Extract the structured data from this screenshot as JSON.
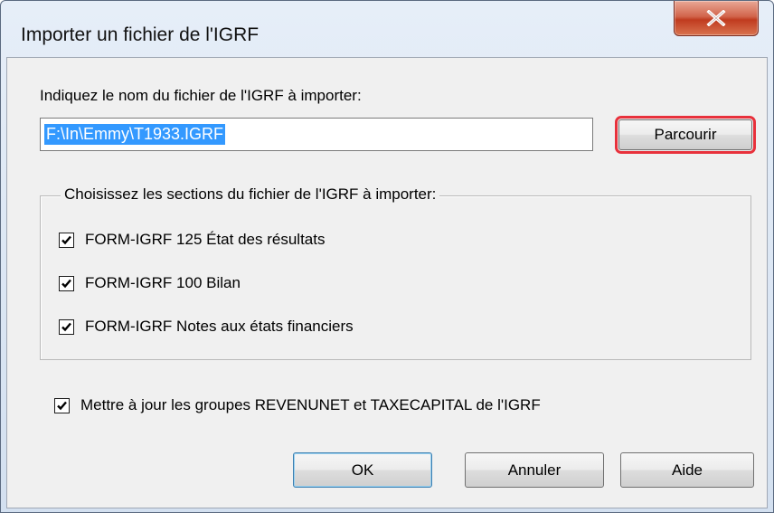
{
  "window": {
    "title": "Importer un fichier de l'IGRF",
    "close_glyph": "X"
  },
  "file": {
    "label": "Indiquez le nom du fichier de l'IGRF à importer:",
    "value": "F:\\In\\Emmy\\T1933.IGRF",
    "browse_label": "Parcourir"
  },
  "sections": {
    "legend": "Choisissez les sections du fichier de l'IGRF à importer:",
    "items": [
      {
        "label": "FORM-IGRF  125 État des résultats",
        "checked": true
      },
      {
        "label": "FORM-IGRF  100 Bilan",
        "checked": true
      },
      {
        "label": "FORM-IGRF  Notes aux états financiers",
        "checked": true
      }
    ]
  },
  "update_option": {
    "label": "Mettre à jour les groupes REVENUNET et TAXECAPITAL de l'IGRF",
    "checked": true
  },
  "buttons": {
    "ok": "OK",
    "cancel": "Annuler",
    "help": "Aide"
  },
  "colors": {
    "selection": "#3399ff",
    "focus_outline": "#e8313c",
    "close_button": "#c03b1f"
  }
}
